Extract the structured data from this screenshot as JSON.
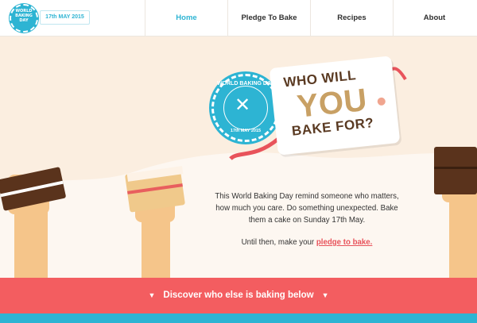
{
  "header": {
    "logo_text": "WORLD BAKING DAY",
    "date": "17th MAY 2015",
    "nav": [
      {
        "label": "Home",
        "active": true
      },
      {
        "label": "Pledge To Bake",
        "active": false
      },
      {
        "label": "Recipes",
        "active": false
      },
      {
        "label": "About",
        "active": false
      }
    ]
  },
  "hero": {
    "seal_top": "WORLD BAKING DAY",
    "seal_bottom": "17th MAY 2015",
    "tag_line1": "WHO WILL",
    "tag_line2": "YOU",
    "tag_line3": "BAKE FOR?",
    "intro": "This World Baking Day remind someone who matters, how much you care. Do something unexpected. Bake them a cake on Sunday 17th May.",
    "cta_prefix": "Until then, make your ",
    "cta_link": "pledge to bake."
  },
  "discover": {
    "label": "Discover who else is baking below"
  },
  "colors": {
    "accent_blue": "#2db4d3",
    "accent_red": "#f35d60",
    "brown": "#5a3a22",
    "gold": "#c8a064"
  }
}
